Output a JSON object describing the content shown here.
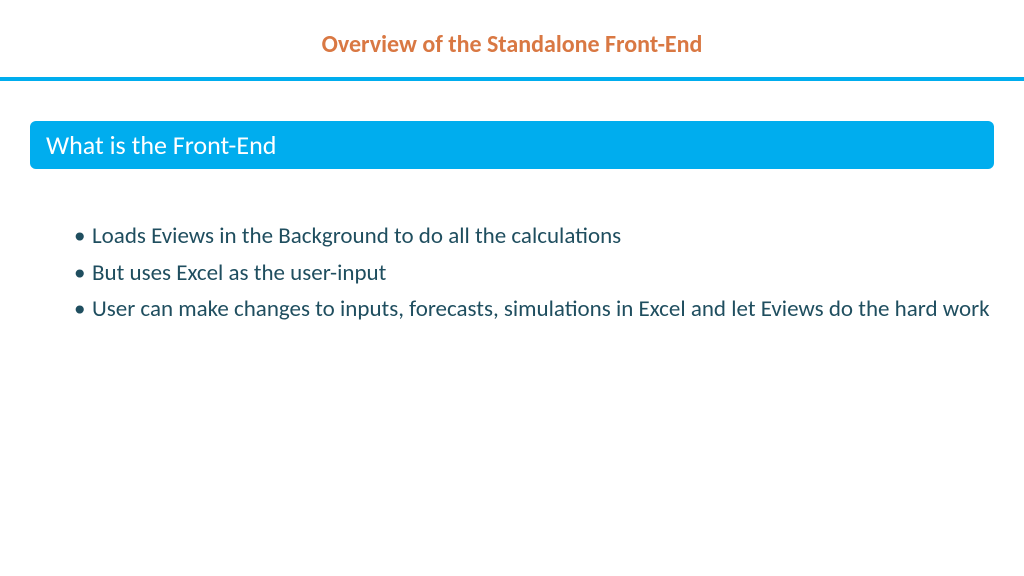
{
  "colors": {
    "accent_orange": "#d97843",
    "accent_blue": "#00adee",
    "text_dark": "#1f4e5f"
  },
  "slide": {
    "title": "Overview of the Standalone Front-End",
    "section_header": "What is the Front-End",
    "bullets": [
      "Loads Eviews in the Background to do all the calculations",
      "But uses Excel as the user-input",
      "User can make changes to inputs, forecasts, simulations in Excel and let Eviews do the hard work"
    ]
  }
}
